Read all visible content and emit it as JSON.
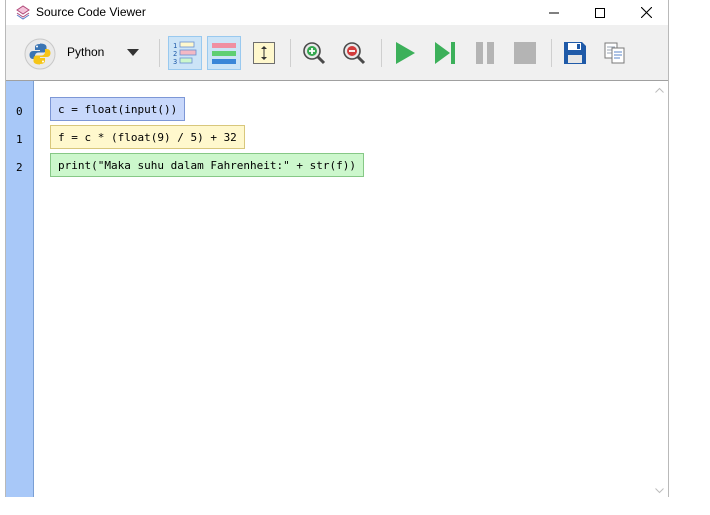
{
  "window": {
    "title": "Source Code Viewer"
  },
  "toolbar": {
    "language": "Python",
    "buttons": [
      "python-logo",
      "language-dropdown",
      "line-numbers",
      "highlight-lines",
      "fit-height",
      "zoom-in",
      "zoom-out",
      "run",
      "step",
      "pause",
      "stop",
      "save",
      "copy"
    ]
  },
  "code": {
    "lines": [
      {
        "number": "0",
        "text": "c = float(input())",
        "bg": "#c8d8fb",
        "border": "#7d97d6"
      },
      {
        "number": "1",
        "text": "f = c * (float(9) / 5) + 32",
        "bg": "#fff8cd",
        "border": "#d8c77c"
      },
      {
        "number": "2",
        "text": "print(\"Maka suhu dalam Fahrenheit:\" + str(f))",
        "bg": "#ccf7cc",
        "border": "#86c886"
      }
    ]
  },
  "colors": {
    "gutter": "#a8c8f8",
    "run_green": "#3cb05a",
    "disabled_gray": "#b4b4b4",
    "save_blue": "#1f5aa8"
  }
}
